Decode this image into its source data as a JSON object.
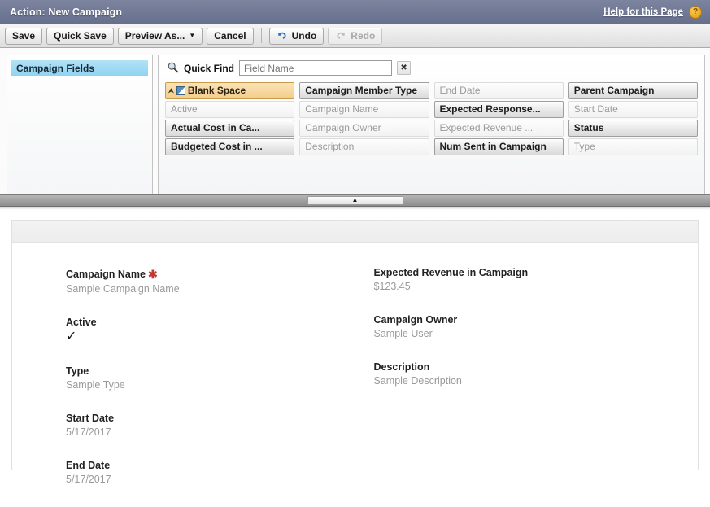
{
  "window": {
    "title": "Action: New Campaign",
    "help_link": "Help for this Page",
    "help_badge": "?"
  },
  "toolbar": {
    "save_label": "Save",
    "quick_save_label": "Quick Save",
    "preview_as_label": "Preview As...",
    "preview_as_caret": "▼",
    "cancel_label": "Cancel",
    "undo_label": "Undo",
    "redo_label": "Redo"
  },
  "palette": {
    "categories": [
      {
        "label": "Campaign Fields",
        "selected": true
      }
    ],
    "quick_find": {
      "label": "Quick Find",
      "icon": "search-icon",
      "value": "",
      "placeholder": "Field Name",
      "clear_icon": "✖"
    },
    "fields": [
      {
        "label": "Blank Space",
        "state": "blank"
      },
      {
        "label": "Campaign Member Type",
        "state": "available"
      },
      {
        "label": "End Date",
        "state": "used"
      },
      {
        "label": "Parent Campaign",
        "state": "available"
      },
      {
        "label": "Active",
        "state": "used"
      },
      {
        "label": "Campaign Name",
        "state": "used"
      },
      {
        "label": "Expected Response...",
        "state": "available"
      },
      {
        "label": "Start Date",
        "state": "used"
      },
      {
        "label": "Actual Cost in Ca...",
        "state": "available"
      },
      {
        "label": "Campaign Owner",
        "state": "used"
      },
      {
        "label": "Expected Revenue ...",
        "state": "used"
      },
      {
        "label": "Status",
        "state": "available"
      },
      {
        "label": "Budgeted Cost in ...",
        "state": "available"
      },
      {
        "label": "Description",
        "state": "used"
      },
      {
        "label": "Num Sent in Campaign",
        "state": "available"
      },
      {
        "label": "Type",
        "state": "used"
      }
    ]
  },
  "splitter": {
    "collapse_icon": "▲"
  },
  "preview": {
    "left_column": [
      {
        "label": "Campaign Name",
        "required": true,
        "value": "Sample Campaign Name",
        "type": "text"
      },
      {
        "label": "Active",
        "required": false,
        "value": "✓",
        "type": "checkbox"
      },
      {
        "label": "Type",
        "required": false,
        "value": "Sample Type",
        "type": "text"
      },
      {
        "label": "Start Date",
        "required": false,
        "value": "5/17/2017",
        "type": "text"
      },
      {
        "label": "End Date",
        "required": false,
        "value": "5/17/2017",
        "type": "text"
      }
    ],
    "right_column": [
      {
        "label": "Expected Revenue in Campaign",
        "required": false,
        "value": "$123.45",
        "type": "text"
      },
      {
        "label": "Campaign Owner",
        "required": false,
        "value": "Sample User",
        "type": "text"
      },
      {
        "label": "Description",
        "required": false,
        "value": "Sample Description",
        "type": "text"
      }
    ]
  },
  "colors": {
    "titlebar": "#6f7893",
    "accent_selected": "#8fd2ef",
    "blank_space": "#f2cd8c",
    "required_star": "#c23934",
    "undo_icon": "#1b73c4"
  }
}
